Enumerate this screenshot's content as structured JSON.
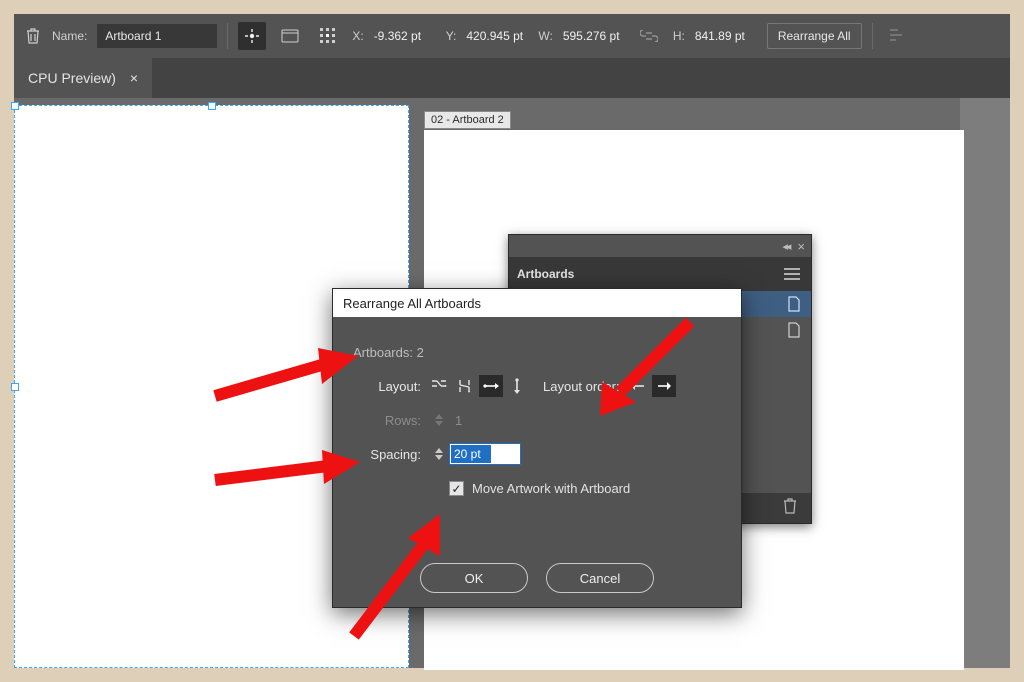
{
  "optionsbar": {
    "name_label": "Name:",
    "name_value": "Artboard 1",
    "x_label": "X:",
    "x_value": "-9.362 pt",
    "y_label": "Y:",
    "y_value": "420.945 pt",
    "w_label": "W:",
    "w_value": "595.276 pt",
    "h_label": "H:",
    "h_value": "841.89 pt",
    "rearrange_label": "Rearrange All"
  },
  "tab": {
    "title": "CPU Preview)",
    "close": "×"
  },
  "artboard2_tag": "02 - Artboard 2",
  "artboards_panel": {
    "title": "Artboards",
    "collapse": "◂◂",
    "close": "×"
  },
  "dialog": {
    "title": "Rearrange All Artboards",
    "artboards_label": "Artboards: 2",
    "layout_label": "Layout:",
    "layout_order_label": "Layout order:",
    "rows_label": "Rows:",
    "rows_value": "1",
    "spacing_label": "Spacing:",
    "spacing_value": "20 pt",
    "move_label": "Move Artwork with Artboard",
    "checkmark": "✓",
    "ok": "OK",
    "cancel": "Cancel"
  }
}
